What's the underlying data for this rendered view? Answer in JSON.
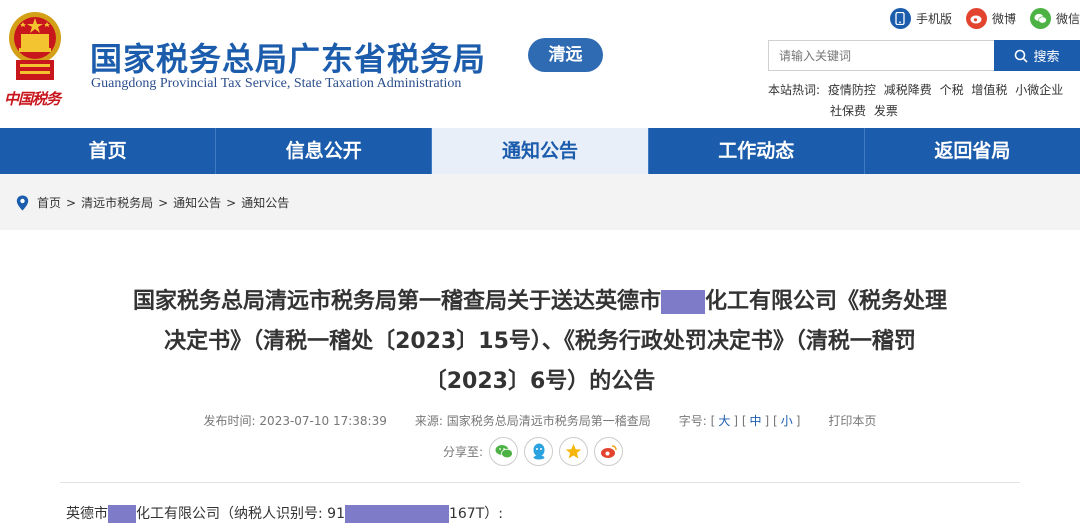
{
  "header": {
    "logo_text": "中国税务",
    "title": "国家税务总局广东省税务局",
    "subtitle": "Guangdong Provincial Tax Service, State Taxation Administration",
    "city_badge": "清远"
  },
  "top_links": [
    {
      "label": "手机版",
      "icon": "mobile-icon",
      "color": "#1c5cac"
    },
    {
      "label": "微博",
      "icon": "weibo-icon",
      "color": "#e2442f"
    },
    {
      "label": "微信",
      "icon": "wechat-icon",
      "color": "#4cb244"
    }
  ],
  "search": {
    "placeholder": "请输入关键词",
    "button_label": "搜索"
  },
  "hotwords": {
    "label": "本站热词:",
    "items": [
      "疫情防控",
      "减税降费",
      "个税",
      "增值税",
      "小微企业",
      "社保费",
      "发票"
    ]
  },
  "nav": {
    "items": [
      "首页",
      "信息公开",
      "通知公告",
      "工作动态",
      "返回省局"
    ],
    "active_index": 2
  },
  "breadcrumb": {
    "items": [
      "首页",
      "清远市税务局",
      "通知公告",
      "通知公告"
    ],
    "separator": ">"
  },
  "article": {
    "title_line1_a": "国家税务总局清远市税务局第一稽查局关于送达英德市",
    "title_line1_b": "化工有限公司《税务处理",
    "title_line2": "决定书》（清税一稽处〔2023〕15号）、《税务行政处罚决定书》（清税一稽罚",
    "title_line3": "〔2023〕6号）的公告",
    "publish_label": "发布时间:",
    "publish_time": "2023-07-10 17:38:39",
    "source_label": "来源:",
    "source": "国家税务总局清远市税务局第一稽查局",
    "font_label": "字号:",
    "font_sizes": [
      "大",
      "中",
      "小"
    ],
    "print_label": "打印本页",
    "share_label": "分享至:",
    "share_icons": [
      "wechat-icon",
      "qq-icon",
      "qzone-icon",
      "weibo-icon"
    ],
    "body_part1": "英德市",
    "body_part2": "化工有限公司（纳税人识别号: 91",
    "body_part3": "167T）:"
  },
  "colors": {
    "primary": "#1c5cac",
    "redaction": "#7e7bc9",
    "crumb_bg": "#f3f3f3"
  }
}
